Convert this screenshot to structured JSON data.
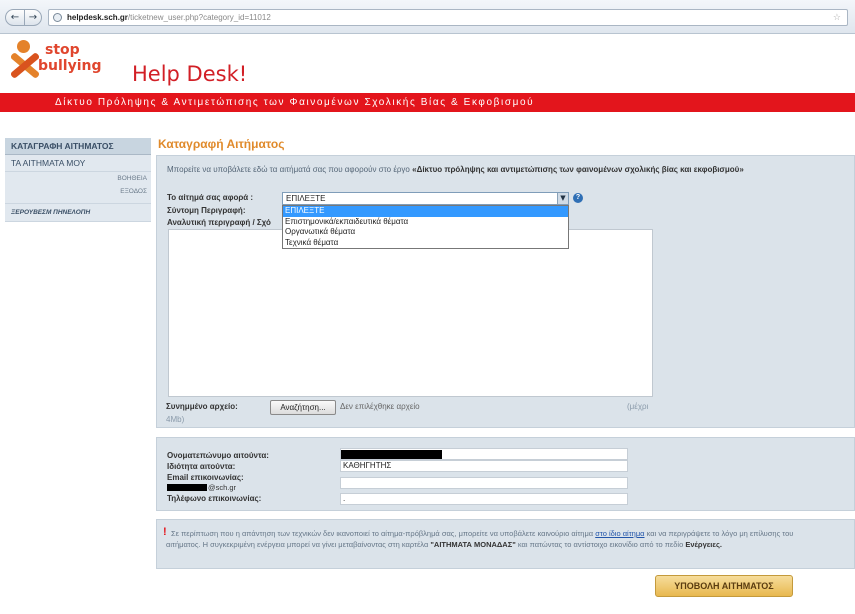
{
  "browser": {
    "url_host": "helpdesk.sch.gr",
    "url_path": "/ticketnew_user.php?category_id=11012"
  },
  "header": {
    "logo_line1": "stop",
    "logo_line2": "bullying",
    "title": "Help Desk!",
    "banner": "Δίκτυο Πρόληψης & Αντιμετώπισης των Φαινομένων Σχολικής Βίας & Εκφοβισμού"
  },
  "sidebar": {
    "items": [
      "ΚΑΤΑΓΡΑΦΗ ΑΙΤΗΜΑΤΟΣ",
      "ΤΑ ΑΙΤΗΜΑΤΑ ΜΟΥ"
    ],
    "help": "ΒΟΗΘΕΙΑ",
    "logout": "ΕΞΟΔΟΣ",
    "user": "ΞΕΡΟΥΒΕΣΜ ΠΗΝΕΛΟΠΗ"
  },
  "main": {
    "title": "Καταγραφή Αιτήματος",
    "intro_text": "Μπορείτε να υποβάλετε εδώ τα αιτήματά σας που αφορούν στο έργο",
    "intro_bold": "«Δίκτυο πρόληψης και αντιμετώπισης των φαινομένων σχολικής βίας και εκφοβισμού»",
    "form": {
      "category_label": "Το αίτημά σας αφορά :",
      "category_value": "ΕΠΙΛΕΞΤΕ",
      "category_options": [
        "ΕΠΙΛΕΞΤΕ",
        "Επιστημονικά/εκπαιδευτικά θέματα",
        "Οργανωτικά θέματα",
        "Τεχνικά θέματα"
      ],
      "short_desc_label": "Σύντομη Περιγραφή:",
      "long_desc_label": "Αναλυτική περιγραφή / Σχό",
      "attachment_label": "Συνημμένο αρχείο:",
      "browse_label": "Αναζήτηση...",
      "no_file": "Δεν επιλέχθηκε αρχείο",
      "max_size": "(μέχρι",
      "max_size_2": "4Mb)"
    },
    "contact": {
      "name_label": "Ονοματεπώνυμο αιτούντα:",
      "role_label": "Ιδιότητα αιτούντα:",
      "role_value": "ΚΑΘΗΓΗΤΗΣ",
      "email_label": "Email επικοινωνίας:",
      "email_domain": "@sch.gr",
      "phone_label": "Τηλέφωνο επικοινωνίας:",
      "phone_value": "."
    },
    "notice": {
      "icon": "!",
      "text1": "Σε περίπτωση που η απάντηση των τεχνικών δεν ικανοποιεί το αίτημα-πρόβλημά σας, μπορείτε να υποβάλετε καινούριο αίτημα",
      "link": "στο ίδιο αίτημα",
      "text2": "και να περιγράψετε το λόγο μη επίλυσης του αιτήματος. Η συγκεκριμένη ενέργεια μπορεί να γίνει μεταβαίνοντας στη καρτέλα",
      "bold1": "\"ΑΙΤΗΜΑΤΑ ΜΟΝΑΔΑΣ\"",
      "text3": "και πατώντας το αντίστοιχο εικονίδιο από το πεδίο",
      "bold2": "Ενέργειες."
    },
    "submit_label": "ΥΠΟΒΟΛΗ ΑΙΤΗΜΑΤΟΣ"
  },
  "colors": {
    "brand_red": "#e3151c",
    "title_orange": "#e08a2b",
    "panel_bg": "#dbe3ea"
  }
}
